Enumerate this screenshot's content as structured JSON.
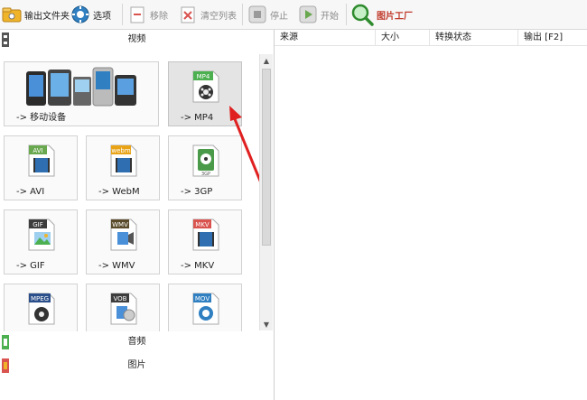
{
  "toolbar": {
    "output_folder": "输出文件夹",
    "options": "选项",
    "remove": "移除",
    "clear_list": "清空列表",
    "stop": "停止",
    "start": "开始",
    "picture_factory": "图片工厂"
  },
  "categories": {
    "video": "视频",
    "audio": "音频",
    "picture": "图片"
  },
  "tiles": [
    {
      "label": "-> 移动设备",
      "icon": "mobile-devices-icon"
    },
    {
      "label": "-> MP4",
      "badge": "MP4",
      "color": "#4caf50",
      "icon": "mp4-file-icon"
    },
    {
      "label": "-> AVI",
      "badge": "AVI",
      "color": "#6aa84f",
      "icon": "avi-file-icon"
    },
    {
      "label": "-> WebM",
      "badge": "webm",
      "color": "#e8a317",
      "icon": "webm-file-icon"
    },
    {
      "label": "-> 3GP",
      "badge": "3GP",
      "color": "#4a9a4a",
      "icon": "3gp-file-icon"
    },
    {
      "label": "-> GIF",
      "badge": "GIF",
      "color": "#3d3d3d",
      "icon": "gif-file-icon"
    },
    {
      "label": "-> WMV",
      "badge": "WMV",
      "color": "#5a4a2a",
      "icon": "wmv-file-icon"
    },
    {
      "label": "-> MKV",
      "badge": "MKV",
      "color": "#d9534f",
      "icon": "mkv-file-icon"
    },
    {
      "label": "",
      "badge": "MPEG",
      "color": "#2b4f8a",
      "icon": "mpeg-file-icon"
    },
    {
      "label": "",
      "badge": "VOB",
      "color": "#3d3d3d",
      "icon": "vob-file-icon"
    },
    {
      "label": "",
      "badge": "MOV",
      "color": "#2f7fc1",
      "icon": "mov-file-icon"
    }
  ],
  "columns": {
    "source": "来源",
    "size": "大小",
    "status": "转换状态",
    "output": "输出 [F2]"
  }
}
